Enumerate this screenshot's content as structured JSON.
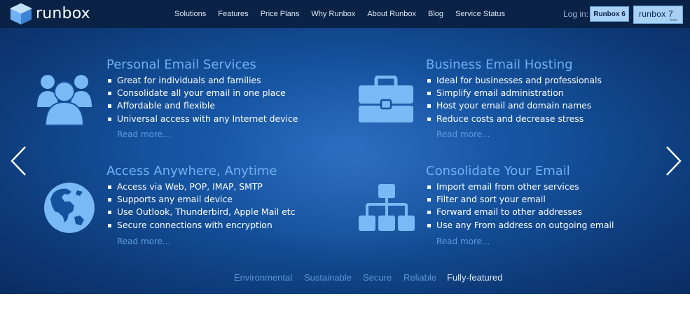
{
  "brand": {
    "name": "runbox"
  },
  "nav": {
    "items": [
      "Solutions",
      "Features",
      "Price Plans",
      "Why Runbox",
      "About Runbox",
      "Blog",
      "Service Status"
    ]
  },
  "login": {
    "label": "Log in:",
    "runbox6": "Runbox 6",
    "runbox7": "runbox 7",
    "runbox7_badge": "beta"
  },
  "features": [
    {
      "title": "Personal Email Services",
      "icon": "users-group-icon",
      "bullets": [
        "Great for individuals and families",
        "Consolidate all your email in one place",
        "Affordable and flexible",
        "Universal access with any Internet device"
      ],
      "read_more": "Read more..."
    },
    {
      "title": "Business Email Hosting",
      "icon": "briefcase-icon",
      "bullets": [
        "Ideal for businesses and professionals",
        "Simplify email administration",
        "Host your email and domain names",
        "Reduce costs and decrease stress"
      ],
      "read_more": "Read more..."
    },
    {
      "title": "Access Anywhere, Anytime",
      "icon": "globe-icon",
      "bullets": [
        "Access via Web, POP, IMAP, SMTP",
        "Supports any email device",
        "Use Outlook, Thunderbird, Apple Mail etc",
        "Secure connections with encryption"
      ],
      "read_more": "Read more..."
    },
    {
      "title": "Consolidate Your Email",
      "icon": "sitemap-icon",
      "bullets": [
        "Import email from other services",
        "Filter and sort your email",
        "Forward email to other addresses",
        "Use any From address on outgoing email"
      ],
      "read_more": "Read more..."
    }
  ],
  "taglines": {
    "items": [
      "Environmental",
      "Sustainable",
      "Secure",
      "Reliable",
      "Fully-featured"
    ],
    "active_index": 4
  },
  "colors": {
    "header_bg": "#0a2246",
    "hero_blue": "#15529e",
    "title_blue": "#6fb1f2",
    "icon_blue": "#79b9f5",
    "button_blue": "#a8d1f5"
  }
}
